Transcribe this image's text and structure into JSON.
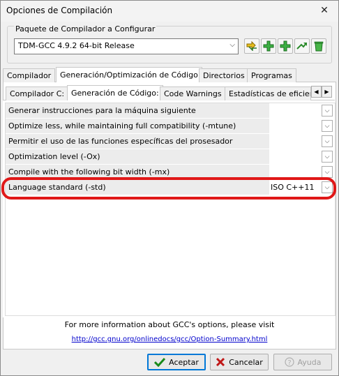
{
  "window": {
    "title": "Opciones de Compilación"
  },
  "package_group": {
    "label": "Paquete de Compilador a Configurar",
    "selected": "TDM-GCC 4.9.2 64-bit Release"
  },
  "toolbar_icons": [
    "rename-icon",
    "add-icon",
    "add-copy-icon",
    "rename-arrow-icon",
    "delete-icon"
  ],
  "main_tabs": [
    "Compilador",
    "Generación/Optimización de Código",
    "Directorios",
    "Programas"
  ],
  "sub_tabs": [
    "Compilador C:",
    "Generación de Código:",
    "Code Warnings",
    "Estadísticas de eficien"
  ],
  "options": [
    {
      "label": "Generar instrucciones para la máquina siguiente",
      "value": ""
    },
    {
      "label": "Optimize less, while maintaining full compatibility (-mtune)",
      "value": ""
    },
    {
      "label": "Permitir el uso de las funciones específicas del prosesador",
      "value": ""
    },
    {
      "label": "Optimization level (-Ox)",
      "value": ""
    },
    {
      "label": "Compile with the following bit width (-mx)",
      "value": ""
    },
    {
      "label": "Language standard (-std)",
      "value": "ISO C++11"
    }
  ],
  "info": {
    "text": "For more information about GCC's options, please visit",
    "link": "http://gcc.gnu.org/onlinedocs/gcc/Option-Summary.html"
  },
  "buttons": {
    "ok": "Aceptar",
    "cancel": "Cancelar",
    "help": "Ayuda"
  },
  "colors": {
    "highlight": "#e01818",
    "accept_check": "#1a8a1a",
    "cancel_x": "#c01818"
  }
}
